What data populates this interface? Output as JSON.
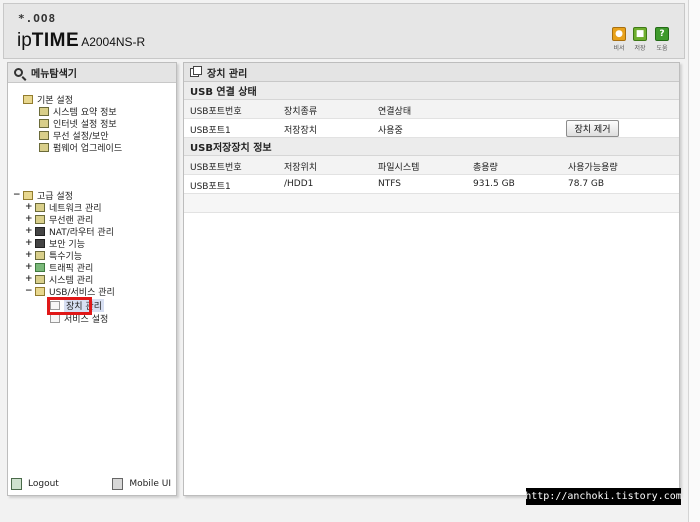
{
  "header": {
    "logo_top": "*.OO8",
    "brand_prefix": "ip",
    "brand_bold": "TIME",
    "model": "A2004NS-R",
    "icons": [
      {
        "name": "admin-icon",
        "label": "비서",
        "color": "#e8a21c"
      },
      {
        "name": "save-icon",
        "label": "저장",
        "color": "#6fae2e"
      },
      {
        "name": "help-icon",
        "label": "도움",
        "color": "#3f9a2c",
        "glyph": "?"
      }
    ]
  },
  "sidebar": {
    "title": "메뉴탐색기",
    "basic": {
      "label": "기본 설정",
      "items": [
        "시스템 요약 정보",
        "인터넷 설정 정보",
        "무선 설정/보안",
        "펌웨어 업그레이드"
      ]
    },
    "advanced": {
      "label": "고급 설정",
      "items": [
        "네트워크 관리",
        "무선랜 관리",
        "NAT/라우터 관리",
        "보안 기능",
        "특수기능",
        "트래픽 관리",
        "시스템 관리",
        "USB/서비스 관리"
      ],
      "usb_children": [
        "장치 관리",
        "서비스 설정"
      ]
    },
    "footer": {
      "logout": "Logout",
      "mobile": "Mobile UI"
    }
  },
  "main": {
    "title": "장치 관리",
    "usb_status": {
      "section": "USB 연결 상태",
      "headers": [
        "USB포트번호",
        "장치종류",
        "연결상태"
      ],
      "rows": [
        {
          "port": "USB포트1",
          "type": "저장장치",
          "state": "사용중",
          "button": "장치 제거"
        }
      ]
    },
    "storage": {
      "section": "USB저장장치 정보",
      "headers": [
        "USB포트번호",
        "저장위치",
        "파일시스템",
        "총용량",
        "사용가능용량"
      ],
      "rows": [
        {
          "port": "USB포트1",
          "location": "/HDD1",
          "fs": "NTFS",
          "total": "931.5 GB",
          "free": "78.7 GB"
        }
      ]
    }
  },
  "watermark": "http://anchoki.tistory.com"
}
